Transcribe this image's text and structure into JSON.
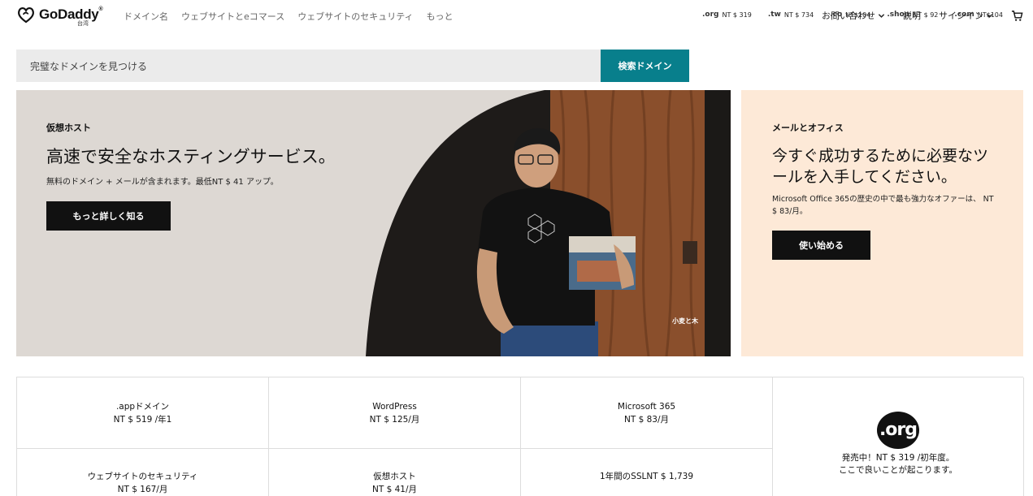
{
  "brand": {
    "name": "GoDaddy",
    "tm": "®",
    "region": "台湾"
  },
  "nav": {
    "items": [
      "ドメイン名",
      "ウェブサイトとeコマース",
      "ウェブサイトのセキュリティ",
      "もっと"
    ],
    "contact": "お問い合わせ",
    "help": "説明",
    "signin": "サインイン"
  },
  "search": {
    "placeholder": "完璧なドメインを見つける",
    "button": "検索ドメイン"
  },
  "tlds": [
    {
      "logo": ".org",
      "price": "NT $ 319"
    },
    {
      "logo": ".tw",
      "price": "NT $ 734"
    },
    {
      "logo": ".co",
      "price": "NT$104"
    },
    {
      "logo": ".shop",
      "price": "NT $ 92"
    },
    {
      "logo": ".com",
      "price": "NT$104"
    }
  ],
  "hero": {
    "eyebrow": "仮想ホスト",
    "title": "高速で安全なホスティングサービス。",
    "subtitle": "無料のドメイン + メールが含まれます。最低NT $ 41 アップ。",
    "button": "もっと詳しく知る",
    "caption": "小麦と木"
  },
  "promo": {
    "eyebrow": "メールとオフィス",
    "title": "今すぐ成功するために必要なツールを入手してください。",
    "subtitle": "Microsoft Office 365の歴史の中で最も強力なオファーは、 NT $ 83/月。",
    "button": "使い始める"
  },
  "products": [
    {
      "name": ".appドメイン",
      "price": "NT $ 519 /年1"
    },
    {
      "name": "WordPress",
      "price": "NT $ 125/月"
    },
    {
      "name": "Microsoft 365",
      "price": "NT $ 83/月"
    },
    {
      "name": "ウェブサイトのセキュリティ",
      "price": "NT $ 167/月"
    },
    {
      "name": "仮想ホスト",
      "price": "NT $ 41/月"
    },
    {
      "name": "1年間のSSLNT $ 1,739",
      "price": ""
    }
  ],
  "org_promo": {
    "logo": ".org",
    "line1": "発売中！NT $ 319 /初年度。",
    "line2": "ここで良いことが起こります。"
  },
  "colors": {
    "accent": "#087f8c",
    "dark_button": "#111111",
    "promo_bg": "#fde9d7"
  }
}
